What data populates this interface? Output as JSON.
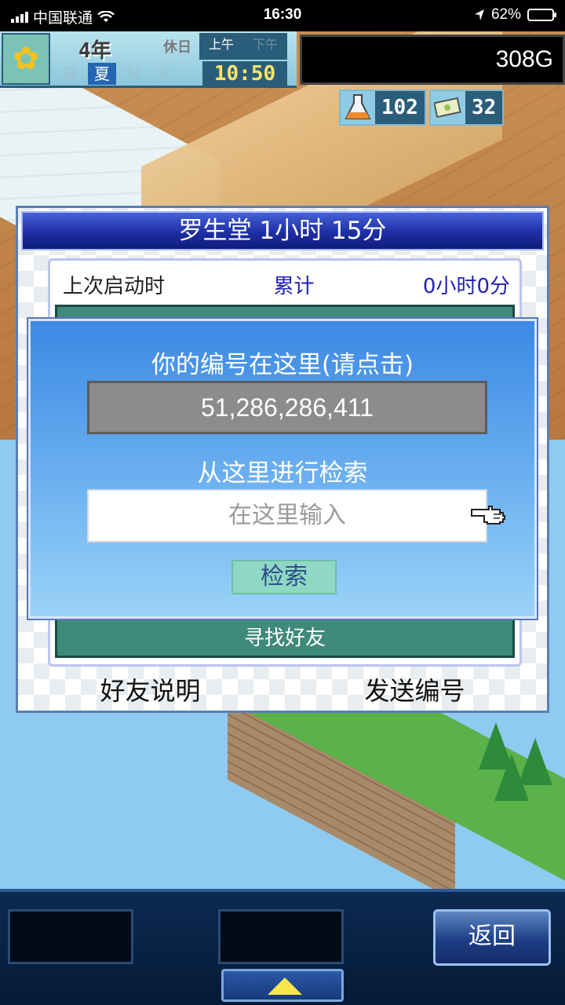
{
  "status_bar": {
    "carrier": "中国联通",
    "time": "16:30",
    "battery": "62%",
    "battery_level": 0.62,
    "icons": [
      "signal-bars-icon",
      "wifi-icon",
      "location-arrow-icon",
      "battery-icon"
    ]
  },
  "hud": {
    "year": "4年",
    "seasons": [
      "春",
      "夏",
      "秋",
      "冬"
    ],
    "active_season": "夏",
    "holiday": "休日",
    "am": "上午",
    "pm": "下午",
    "clock": "10:50",
    "money": "308G",
    "research_points": "102",
    "money_bills": "32",
    "icons": [
      "sunflower-icon",
      "flask-icon",
      "bills-icon"
    ]
  },
  "friend_panel": {
    "title": "罗生堂  1小时 15分",
    "last_launch_label": "上次启动时",
    "total_label": "累计",
    "total_value": "0小时0分",
    "find_friend": "寻找好友",
    "friend_help": "好友说明",
    "send_id": "发送编号"
  },
  "id_dialog": {
    "heading": "你的编号在这里(请点击)",
    "id_number": "51,286,286,411",
    "search_heading": "从这里进行检索",
    "search_placeholder": "在这里输入",
    "search_button": "检索"
  },
  "toolbar": {
    "back_label": "返回"
  },
  "colors": {
    "dialog_blue": "#3c89e4",
    "title_bar": "#1e2fa4",
    "id_box_gray": "#8c8c8c",
    "search_btn": "#8fd8c3",
    "clock_yellow": "#ffe46b"
  }
}
